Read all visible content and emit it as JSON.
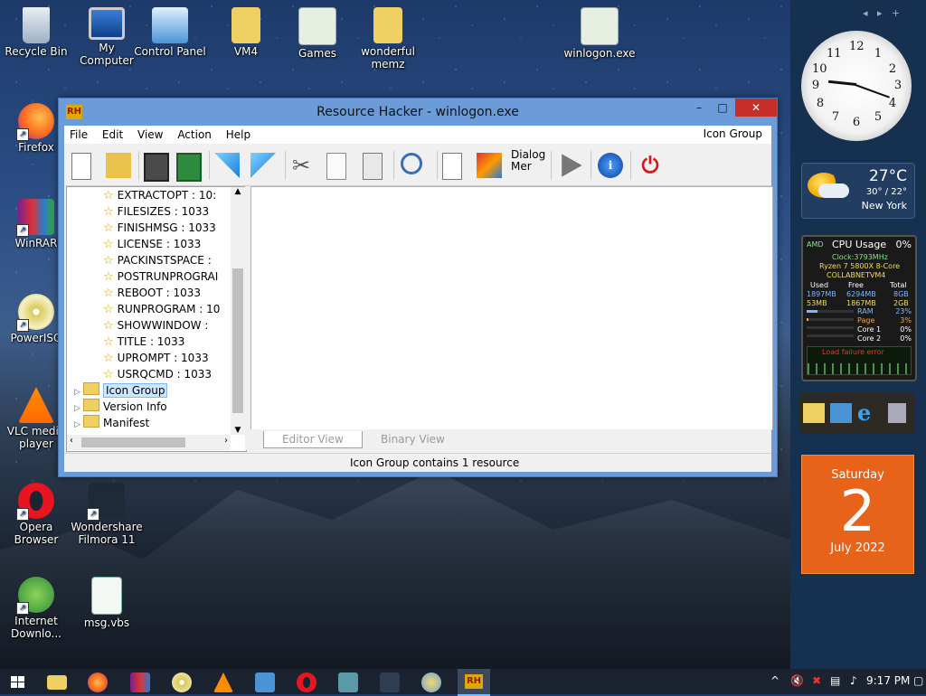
{
  "desktop": {
    "icons": [
      {
        "label": "Recycle Bin"
      },
      {
        "label": "My Computer"
      },
      {
        "label": "Control Panel"
      },
      {
        "label": "VM4"
      },
      {
        "label": "Games"
      },
      {
        "label": "wonderful memz"
      },
      {
        "label": "winlogon.exe"
      },
      {
        "label": "Firefox"
      },
      {
        "label": "WinRAR"
      },
      {
        "label": "PowerISO"
      },
      {
        "label": "VLC media player"
      },
      {
        "label": "Opera Browser"
      },
      {
        "label": "Wondershare Filmora 11"
      },
      {
        "label": "Internet Downlo..."
      },
      {
        "label": "msg.vbs"
      }
    ]
  },
  "window": {
    "logo": "RH",
    "title": "Resource Hacker - winlogon.exe",
    "minimize": "–",
    "maximize": "□",
    "close": "✕",
    "menu": [
      "File",
      "Edit",
      "View",
      "Action",
      "Help"
    ],
    "menu_right": "Icon Group",
    "toolbar_dialog_label_1": "Dialog",
    "toolbar_dialog_label_2": "Mer",
    "tree": {
      "items": [
        "EXTRACTOPT : 10:",
        "FILESIZES : 1033",
        "FINISHMSG : 1033",
        "LICENSE : 1033",
        "PACKINSTSPACE :",
        "POSTRUNPROGRAI",
        "REBOOT : 1033",
        "RUNPROGRAM : 10",
        "SHOWWINDOW :",
        "TITLE : 1033",
        "UPROMPT : 1033",
        "USRQCMD : 1033"
      ],
      "groups": [
        "Icon Group",
        "Version Info",
        "Manifest"
      ]
    },
    "tabs": [
      "Editor View",
      "Binary View"
    ],
    "status": "Icon Group contains 1 resource"
  },
  "gadgets": {
    "clock_numbers": [
      "12",
      "1",
      "2",
      "3",
      "4",
      "5",
      "6",
      "7",
      "8",
      "9",
      "10",
      "11"
    ],
    "weather": {
      "temp": "27°C",
      "range": "30° / 22°",
      "city": "New York"
    },
    "cpu": {
      "title": "CPU Usage",
      "pct": "0%",
      "brand": "AMD",
      "clock": "Clock:3793MHz",
      "model": "Ryzen 7 5800X 8-Core",
      "host": "COLLABNETVM4",
      "headers": [
        "Used",
        "Free",
        "Total"
      ],
      "row1": [
        "1897MB",
        "6294MB",
        "8GB"
      ],
      "row2": [
        "53MB",
        "1867MB",
        "2GB"
      ],
      "meters": [
        {
          "label": "RAM",
          "value": "23%"
        },
        {
          "label": "Page",
          "value": "3%"
        },
        {
          "label": "Core 1",
          "value": "0%"
        },
        {
          "label": "Core 2",
          "value": "0%"
        }
      ],
      "error": "Load failure error"
    },
    "calendar": {
      "day": "Saturday",
      "date": "2",
      "month": "July 2022"
    }
  },
  "taskbar": {
    "time": "9:17 PM",
    "tray_up": "^"
  },
  "colors": {
    "window_frame": "#6b9bd8",
    "close": "#c7302a",
    "calendar": "#e8631a"
  }
}
